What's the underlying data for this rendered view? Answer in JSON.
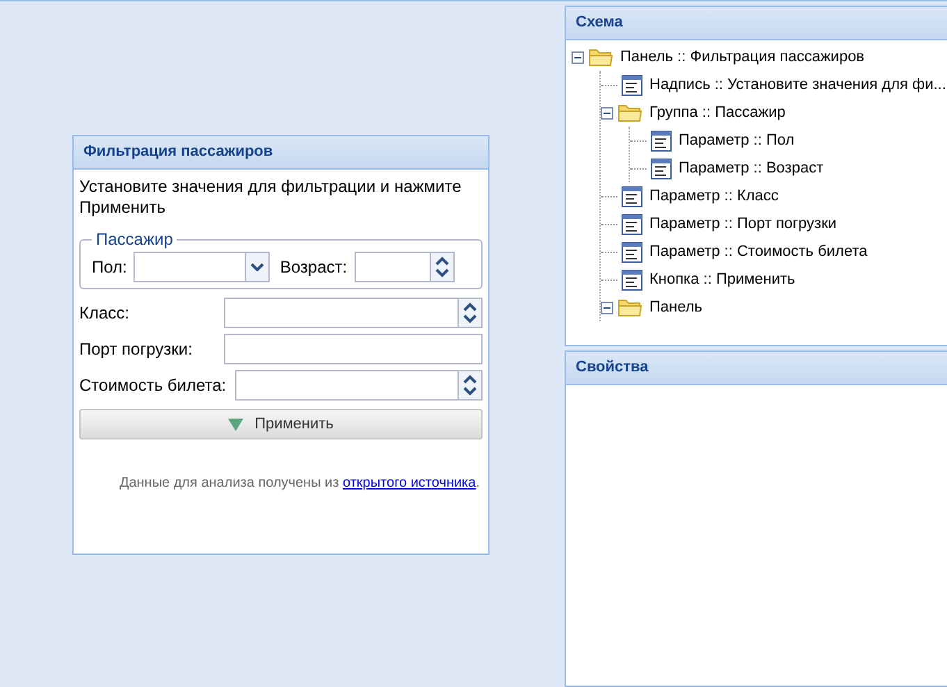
{
  "form": {
    "title": "Фильтрация пассажиров",
    "instruction": "Установите значения для фильтрации и нажмите Применить",
    "group": {
      "legend": "Пассажир",
      "sex_label": "Пол:",
      "age_label": "Возраст:"
    },
    "fields": [
      {
        "kind": "spinner",
        "label": "Класс:"
      },
      {
        "kind": "text",
        "label": "Порт погрузки:"
      },
      {
        "kind": "spinner",
        "label": "Стоимость билета:"
      }
    ],
    "apply_button": "Применить",
    "footer": {
      "text": "Данные для анализа получены из ",
      "link": "открытого источника",
      "end": "."
    }
  },
  "schema": {
    "title": "Схема",
    "tree": [
      {
        "kind": "folder",
        "label": "Панель :: Фильтрация пассажиров",
        "expanded": true,
        "children": [
          {
            "kind": "leaf",
            "label": "Надпись :: Установите значения для фи..."
          },
          {
            "kind": "folder",
            "label": "Группа :: Пассажир",
            "expanded": true,
            "children": [
              {
                "kind": "leaf",
                "label": "Параметр :: Пол"
              },
              {
                "kind": "leaf",
                "label": "Параметр :: Возраст"
              }
            ]
          },
          {
            "kind": "leaf",
            "label": "Параметр :: Класс"
          },
          {
            "kind": "leaf",
            "label": "Параметр :: Порт погрузки"
          },
          {
            "kind": "leaf",
            "label": "Параметр :: Стоимость билета"
          },
          {
            "kind": "leaf",
            "label": "Кнопка :: Применить"
          },
          {
            "kind": "folder",
            "label": "Панель",
            "expanded": true
          }
        ]
      }
    ]
  },
  "properties": {
    "title": "Свойства"
  }
}
